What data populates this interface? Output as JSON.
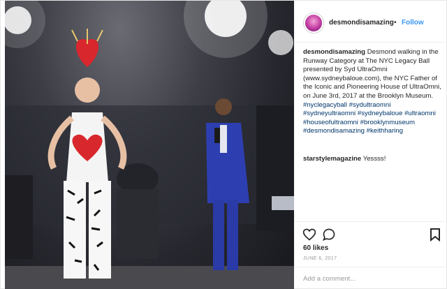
{
  "post": {
    "username": "desmondisamazing",
    "follow_label": "Follow",
    "separator": "•",
    "caption": {
      "username": "desmondisamazing",
      "text": "Desmond walking in the Runway Category at The NYC Legacy Ball presented by Syd UltraOmni (www.sydneybaloue.com), the NYC Father of the Iconic and Pioneering House of UltraOmni, on June 3rd, 2017 at the Brooklyn Museum.",
      "hashtags": [
        "#nyclegacyball",
        "#sydultraomni",
        "#sydneyultraomni",
        "#sydneybaloue",
        "#ultraomni",
        "#houseofultraomni",
        "#brooklynmuseum",
        "#desmondisamazing",
        "#keithharing"
      ]
    },
    "comment": {
      "username": "starstylemagazine",
      "text": "Yessss!"
    },
    "likes": "60 likes",
    "date": "JUNE 6, 2017",
    "add_comment_placeholder": "Add a comment..."
  },
  "icons": {
    "avatar": "profile-avatar",
    "like": "heart-icon",
    "comment": "comment-icon",
    "save": "bookmark-icon"
  },
  "colors": {
    "link": "#3897f0",
    "hashtag": "#003569",
    "text": "#262626",
    "muted": "#999999"
  }
}
